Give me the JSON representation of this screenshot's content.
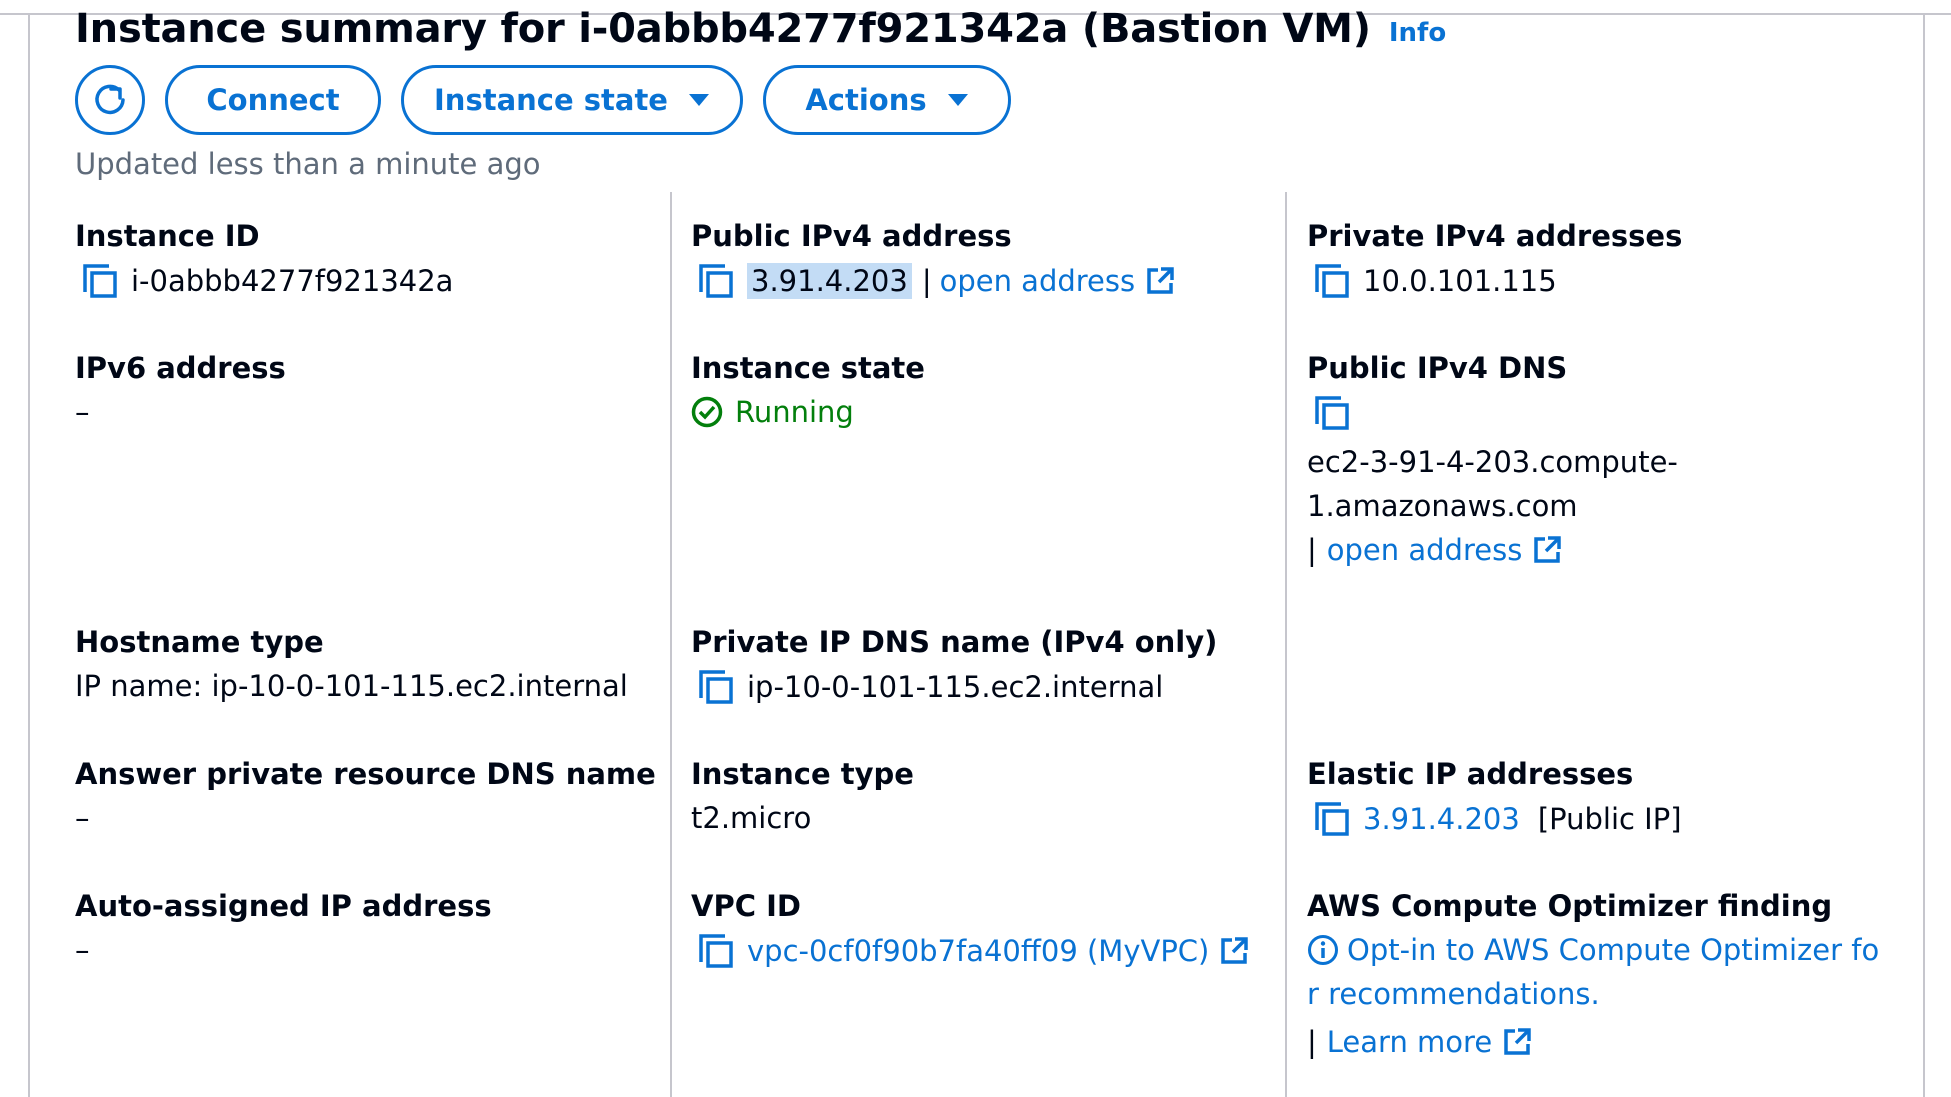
{
  "header": {
    "title": "Instance summary for i-0abbb4277f921342a (Bastion VM)",
    "info_link": "Info"
  },
  "toolbar": {
    "refresh_icon": "refresh-icon",
    "connect_label": "Connect",
    "instance_state_label": "Instance state",
    "actions_label": "Actions",
    "updated_text": "Updated less than a minute ago"
  },
  "fields": {
    "instance_id": {
      "label": "Instance ID",
      "value": "i-0abbb4277f921342a"
    },
    "public_ipv4": {
      "label": "Public IPv4 address",
      "value": "3.91.4.203",
      "separator": "|",
      "link": "open address"
    },
    "private_ipv4": {
      "label": "Private IPv4 addresses",
      "value": "10.0.101.115"
    },
    "ipv6": {
      "label": "IPv6 address",
      "value": "–"
    },
    "instance_state": {
      "label": "Instance state",
      "value": "Running"
    },
    "public_dns": {
      "label": "Public IPv4 DNS",
      "value_line1": "ec2-3-91-4-203.compute-",
      "value_line2": "1.amazonaws.com",
      "separator": "|",
      "link": "open address"
    },
    "hostname_type": {
      "label": "Hostname type",
      "value": "IP name: ip-10-0-101-115.ec2.internal"
    },
    "private_dns": {
      "label": "Private IP DNS name (IPv4 only)",
      "value": "ip-10-0-101-115.ec2.internal"
    },
    "answer_dns": {
      "label": "Answer private resource DNS name",
      "value": "–"
    },
    "instance_type": {
      "label": "Instance type",
      "value": "t2.micro"
    },
    "elastic_ip": {
      "label": "Elastic IP addresses",
      "value": "3.91.4.203",
      "suffix": "[Public IP]"
    },
    "auto_ip": {
      "label": "Auto-assigned IP address",
      "value": "–"
    },
    "vpc_id": {
      "label": "VPC ID",
      "value": "vpc-0cf0f90b7fa40ff09 (MyVPC)"
    },
    "optimizer": {
      "label": "AWS Compute Optimizer finding",
      "line1": "Opt-in to AWS Compute Optimizer fo",
      "line2": "r recommendations.",
      "separator": "|",
      "link": "Learn more"
    }
  },
  "colors": {
    "link": "#0972d3",
    "success": "#037f0c",
    "muted": "#5f6b7a",
    "text": "#000716",
    "border": "#c6c6cd"
  }
}
